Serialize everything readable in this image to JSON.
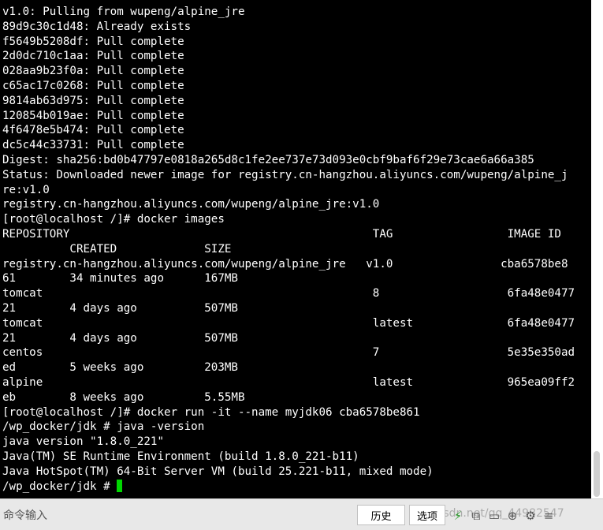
{
  "terminal": {
    "prompt_cursor_color": "#00d700",
    "lines": [
      "v1.0: Pulling from wupeng/alpine_jre",
      "89d9c30c1d48: Already exists",
      "f5649b5208df: Pull complete",
      "2d0dc710c1aa: Pull complete",
      "028aa9b23f0a: Pull complete",
      "c65ac17c0268: Pull complete",
      "9814ab63d975: Pull complete",
      "120854b019ae: Pull complete",
      "4f6478e5b474: Pull complete",
      "dc5c44c33731: Pull complete",
      "Digest: sha256:bd0b47797e0818a265d8c1fe2ee737e73d093e0cbf9baf6f29e73cae6a66a385",
      "Status: Downloaded newer image for registry.cn-hangzhou.aliyuncs.com/wupeng/alpine_j",
      "re:v1.0",
      "registry.cn-hangzhou.aliyuncs.com/wupeng/alpine_jre:v1.0",
      "[root@localhost /]# docker images",
      "REPOSITORY                                             TAG                 IMAGE ID",
      "          CREATED             SIZE",
      "registry.cn-hangzhou.aliyuncs.com/wupeng/alpine_jre   v1.0                cba6578be8",
      "61        34 minutes ago      167MB",
      "tomcat                                                 8                   6fa48e0477",
      "21        4 days ago          507MB",
      "tomcat                                                 latest              6fa48e0477",
      "21        4 days ago          507MB",
      "centos                                                 7                   5e35e350ad",
      "ed        5 weeks ago         203MB",
      "alpine                                                 latest              965ea09ff2",
      "eb        8 weeks ago         5.55MB",
      "[root@localhost /]# docker run -it --name myjdk06 cba6578be861",
      "/wp_docker/jdk # java -version",
      "java version \"1.8.0_221\"",
      "Java(TM) SE Runtime Environment (build 1.8.0_221-b11)",
      "Java HotSpot(TM) 64-Bit Server VM (build 25.221-b11, mixed mode)",
      "/wp_docker/jdk # "
    ]
  },
  "bottom_bar": {
    "command_input_placeholder": "命令输入",
    "history_label": "历史",
    "options_label": "选项",
    "watermark": "blog.csdn.net/qq_44982547"
  },
  "icons": [
    "lightning-icon",
    "copy-icon",
    "folder-icon",
    "zoom-icon",
    "settings-icon",
    "more-icon"
  ],
  "colors": {
    "background": "#000000",
    "text": "#ffffff",
    "cursor": "#00d700",
    "bottom_bar": "#e8e8e8"
  }
}
